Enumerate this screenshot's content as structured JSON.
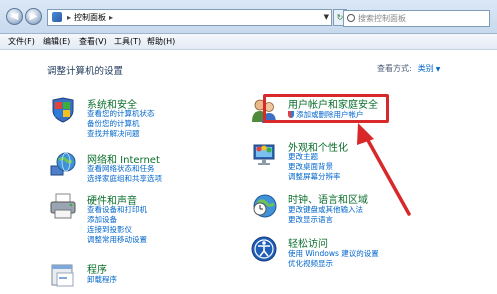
{
  "address_bar": {
    "path_root": "控制面板",
    "search_placeholder": "搜索控制面板"
  },
  "menu": {
    "items": [
      "文件(F)",
      "编辑(E)",
      "查看(V)",
      "工具(T)",
      "帮助(H)"
    ]
  },
  "main": {
    "heading": "调整计算机的设置",
    "view_by_label": "查看方式:",
    "view_by_value": "类别"
  },
  "categories": {
    "system": {
      "title": "系统和安全",
      "links": [
        "查看您的计算机状态",
        "备份您的计算机",
        "查找并解决问题"
      ]
    },
    "network": {
      "title": "网络和 Internet",
      "links": [
        "查看网络状态和任务",
        "选择家庭组和共享选项"
      ]
    },
    "hardware": {
      "title": "硬件和声音",
      "links": [
        "查看设备和打印机",
        "添加设备",
        "连接到投影仪",
        "调整常用移动设置"
      ]
    },
    "programs": {
      "title": "程序",
      "links": [
        "卸载程序"
      ]
    },
    "users": {
      "title": "用户帐户和家庭安全",
      "links": [
        "添加或删除用户帐户"
      ]
    },
    "appearance": {
      "title": "外观和个性化",
      "links": [
        "更改主题",
        "更改桌面背景",
        "调整屏幕分辨率"
      ]
    },
    "clock": {
      "title": "时钟、语言和区域",
      "links": [
        "更改键盘或其他输入法",
        "更改显示语言"
      ]
    },
    "ease": {
      "title": "轻松访问",
      "links": [
        "使用 Windows 建议的设置",
        "优化视频显示"
      ]
    }
  },
  "colors": {
    "category_title": "#0a6e2c",
    "link": "#0066cc",
    "annotation": "#d9282a"
  },
  "icons": {
    "system": "shield-flag-icon",
    "network": "globe-network-icon",
    "hardware": "printer-icon",
    "programs": "programs-icon",
    "users": "users-icon",
    "appearance": "monitor-paint-icon",
    "clock": "clock-globe-icon",
    "ease": "accessibility-icon"
  }
}
